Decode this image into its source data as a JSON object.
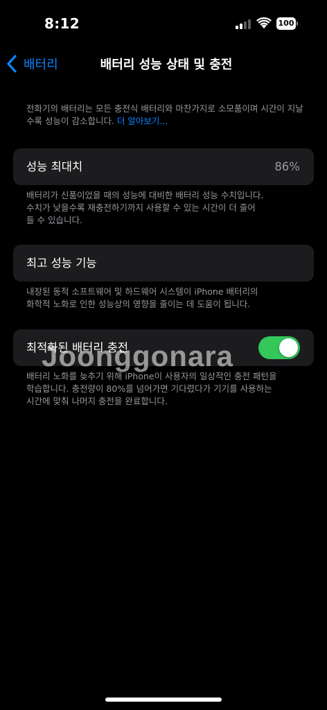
{
  "status_bar": {
    "time": "8:12",
    "battery_level": "100",
    "signal_icon": "cellular-signal-icon",
    "wifi_icon": "wifi-icon"
  },
  "nav": {
    "back_label": "배터리",
    "title": "배터리 성능 상태 및 충전"
  },
  "intro": {
    "text": "전화기의 배터리는 모든 충전식 배터리와 마찬가지로 소모품이며 시간이 지날수록 성능이 감소합니다. ",
    "link": "더 알아보기..."
  },
  "maximum_capacity": {
    "label": "성능 최대치",
    "value": "86%",
    "value_fraction": 0.86,
    "desc_line1": "배터리가 신품이었을 때의 성능에 대비한 배터리 성능 수치입니다.",
    "desc_line2": "수치가 낮을수록 재충전하기까지 사용할 수 있는 시간이 더 줄어",
    "desc_line3": "들 수 있습니다."
  },
  "peak_performance": {
    "label": "최고 성능 기능",
    "desc_line1": "내장된 동적 소프트웨어 및 하드웨어 시스템이 iPhone 배터리의",
    "desc_line2": "화학적 노화로 인한 성능상의 영향을 줄이는 데 도움이 됩니다."
  },
  "optimized_charging": {
    "label": "최적화된 배터리 충전",
    "enabled": true,
    "desc_line1": "배터리 노화를 늦추기 위해 iPhone이 사용자의 일상적인 충전 패턴을",
    "desc_line2": "학습합니다. 충전량이 80%를 넘어가면 기다렸다가 기기를 사용하는",
    "desc_line3": "시간에 맞춰 나머지 충전을 완료합니다."
  },
  "watermark": "Joonggonara",
  "colors": {
    "accent": "#0a84ff",
    "toggle_on": "#34c759",
    "card": "#1c1c1e",
    "secondary_text": "#98989f"
  }
}
